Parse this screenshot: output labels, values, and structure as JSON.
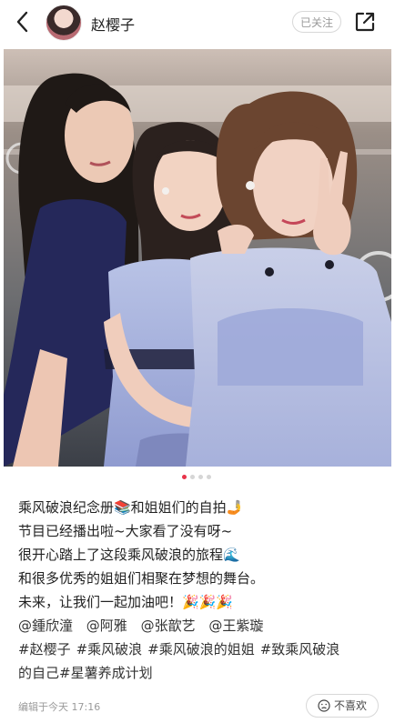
{
  "header": {
    "username": "赵樱子",
    "follow_label": "已关注"
  },
  "gallery": {
    "page_count": 4,
    "active_index": 0
  },
  "post": {
    "lines": [
      "乘风破浪纪念册📚和姐姐们的自拍🤳",
      "节目已经播出啦~大家看了没有呀~",
      "很开心踏上了这段乘风破浪的旅程🌊",
      "和很多优秀的姐姐们相聚在梦想的舞台。",
      "未来，让我们一起加油吧！🎉🎉🎉"
    ],
    "mentions": [
      "@鍾欣潼",
      "@阿雅",
      "@张歆艺",
      "@王紫璇"
    ],
    "tags_line1": [
      "#赵樱子",
      "#乘风破浪",
      "#乘风破浪的姐姐",
      "#致乘风破浪"
    ],
    "tags_line2": "的自己#星薯养成计划"
  },
  "footer": {
    "edited_time": "编辑于今天 17:16",
    "dislike_label": "不喜欢"
  },
  "colors": {
    "accent": "#e8344a",
    "muted": "#9a9a9a"
  }
}
